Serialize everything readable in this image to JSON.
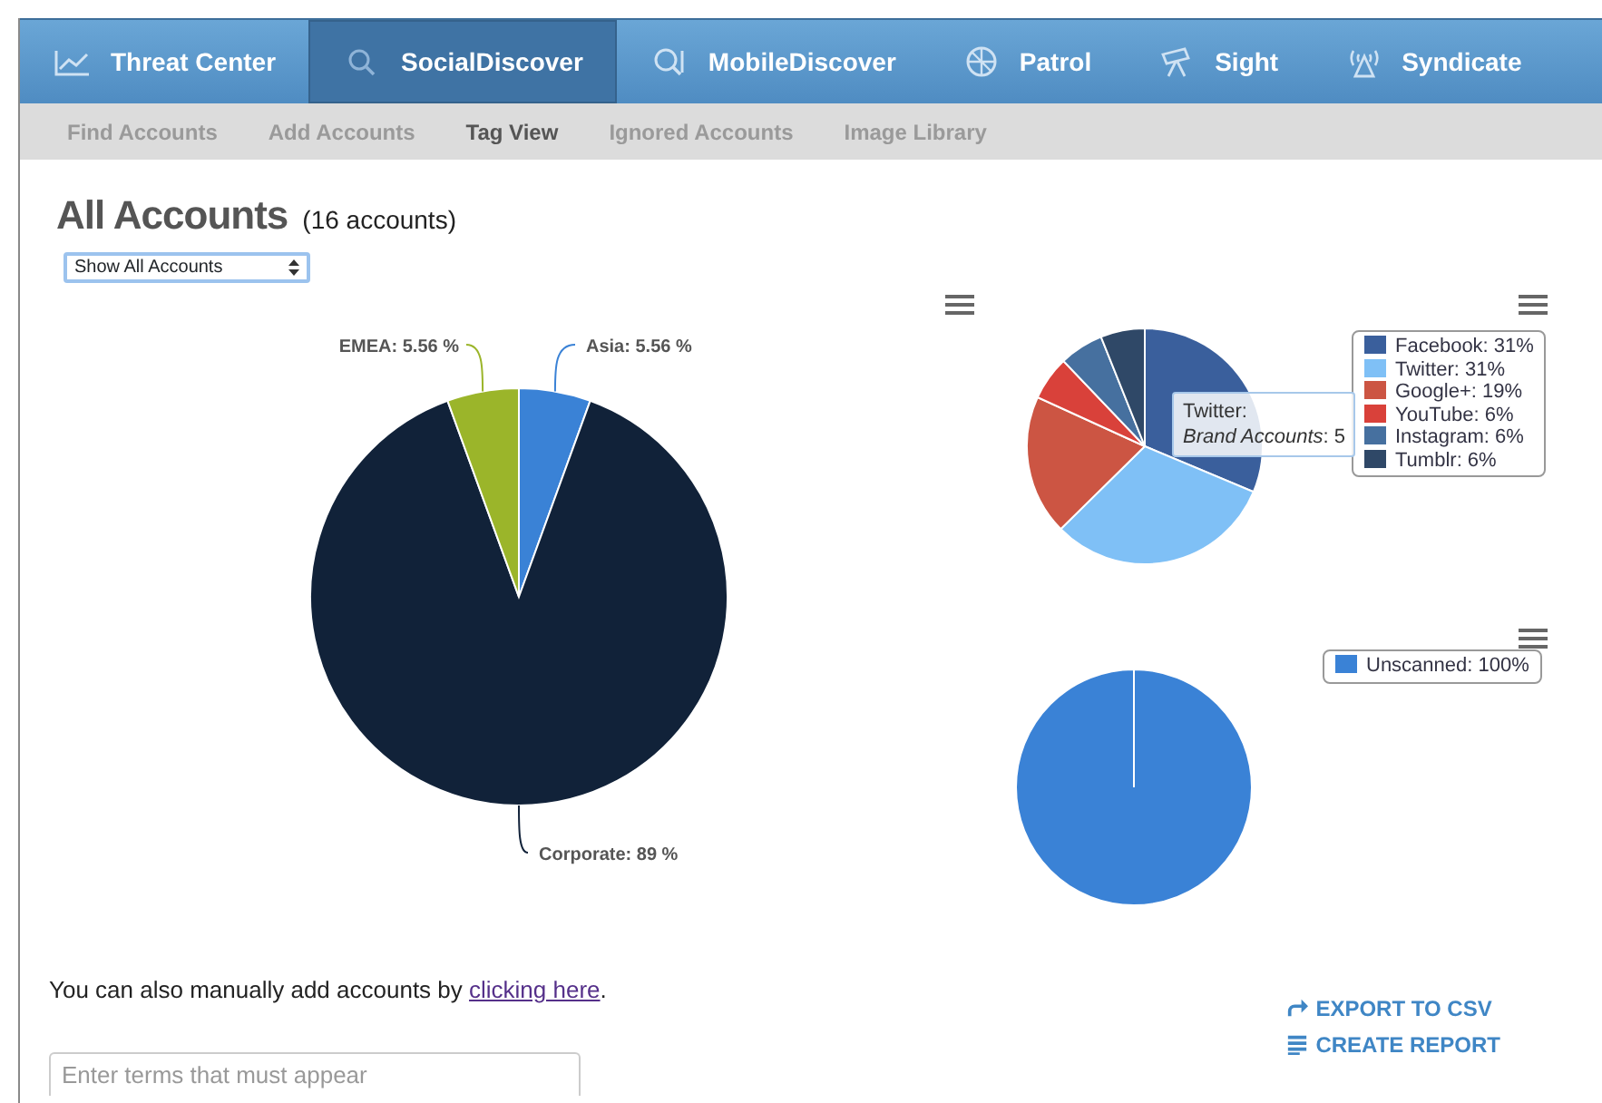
{
  "nav": {
    "tabs": [
      {
        "label": "Threat Center",
        "selected": false
      },
      {
        "label": "SocialDiscover",
        "selected": true
      },
      {
        "label": "MobileDiscover",
        "selected": false
      },
      {
        "label": "Patrol",
        "selected": false
      },
      {
        "label": "Sight",
        "selected": false
      },
      {
        "label": "Syndicate",
        "selected": false
      }
    ]
  },
  "subnav": {
    "items": [
      {
        "label": "Find Accounts",
        "selected": false
      },
      {
        "label": "Add Accounts",
        "selected": false
      },
      {
        "label": "Tag View",
        "selected": true
      },
      {
        "label": "Ignored Accounts",
        "selected": false
      },
      {
        "label": "Image Library",
        "selected": false
      }
    ]
  },
  "page": {
    "title": "All Accounts",
    "count": "(16 accounts)",
    "filter": {
      "value": "Show All Accounts"
    }
  },
  "charts": [
    {
      "chart_data": {
        "type": "pie",
        "categories": [
          "Asia",
          "Corporate",
          "EMEA"
        ],
        "colors": [
          "#3a82d6",
          "#112239",
          "#9bb52a"
        ],
        "values": [
          5.56,
          89,
          5.56
        ],
        "value_labels": [
          "5.56 %",
          "89 %",
          "5.56 %"
        ]
      },
      "label_separator": ": "
    },
    {
      "chart_data": {
        "type": "pie",
        "categories": [
          "Facebook",
          "Twitter",
          "Google+",
          "YouTube",
          "Instagram",
          "Tumblr"
        ],
        "colors": [
          "#3a5f9c",
          "#7fc0f6",
          "#cc5543",
          "#d9413a",
          "#46709f",
          "#2f4867"
        ],
        "values": [
          31,
          31,
          19,
          6,
          6,
          6
        ],
        "value_labels": [
          "31%",
          "31%",
          "19%",
          "6%",
          "6%",
          "6%"
        ],
        "legend": "right"
      },
      "label_separator": ": ",
      "tooltip": {
        "title": "Twitter:",
        "text": "*Brand Accounts*: 5"
      }
    },
    {
      "chart_data": {
        "type": "pie",
        "categories": [
          "Unscanned"
        ],
        "colors": [
          "#3a82d6"
        ],
        "values": [
          100
        ],
        "value_labels": [
          "100%"
        ],
        "legend": "right"
      },
      "label_separator": ": "
    }
  ],
  "note": {
    "text": "You can also manually add accounts by ",
    "link": "clicking here",
    "end": "."
  },
  "actions": [
    "EXPORT TO CSV",
    "CREATE REPORT"
  ],
  "search": {
    "placeholder": "Enter terms that must appear"
  }
}
